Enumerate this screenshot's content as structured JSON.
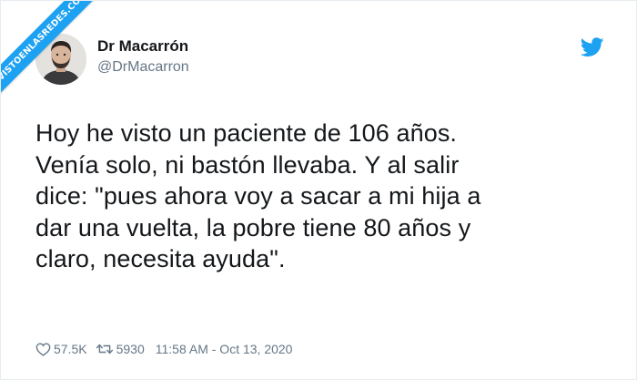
{
  "watermark": {
    "text": "VISTOENLASREDES.COM",
    "color": "#1da1f2"
  },
  "user": {
    "display_name": "Dr Macarrón",
    "handle": "@DrMacarron"
  },
  "platform_icon": "twitter-bird-icon",
  "tweet": {
    "text": "Hoy he visto un paciente de 106 años.\nVenía solo, ni bastón llevaba. Y al salir\ndice: \"pues ahora voy a sacar a mi hija a\ndar una vuelta, la pobre tiene 80 años y\nclaro, necesita ayuda\"."
  },
  "footer": {
    "likes": "57.5K",
    "retweets": "5930",
    "timestamp": "11:58 AM - Oct 13, 2020"
  },
  "colors": {
    "accent": "#1da1f2",
    "text": "#14171a",
    "muted": "#657786"
  }
}
